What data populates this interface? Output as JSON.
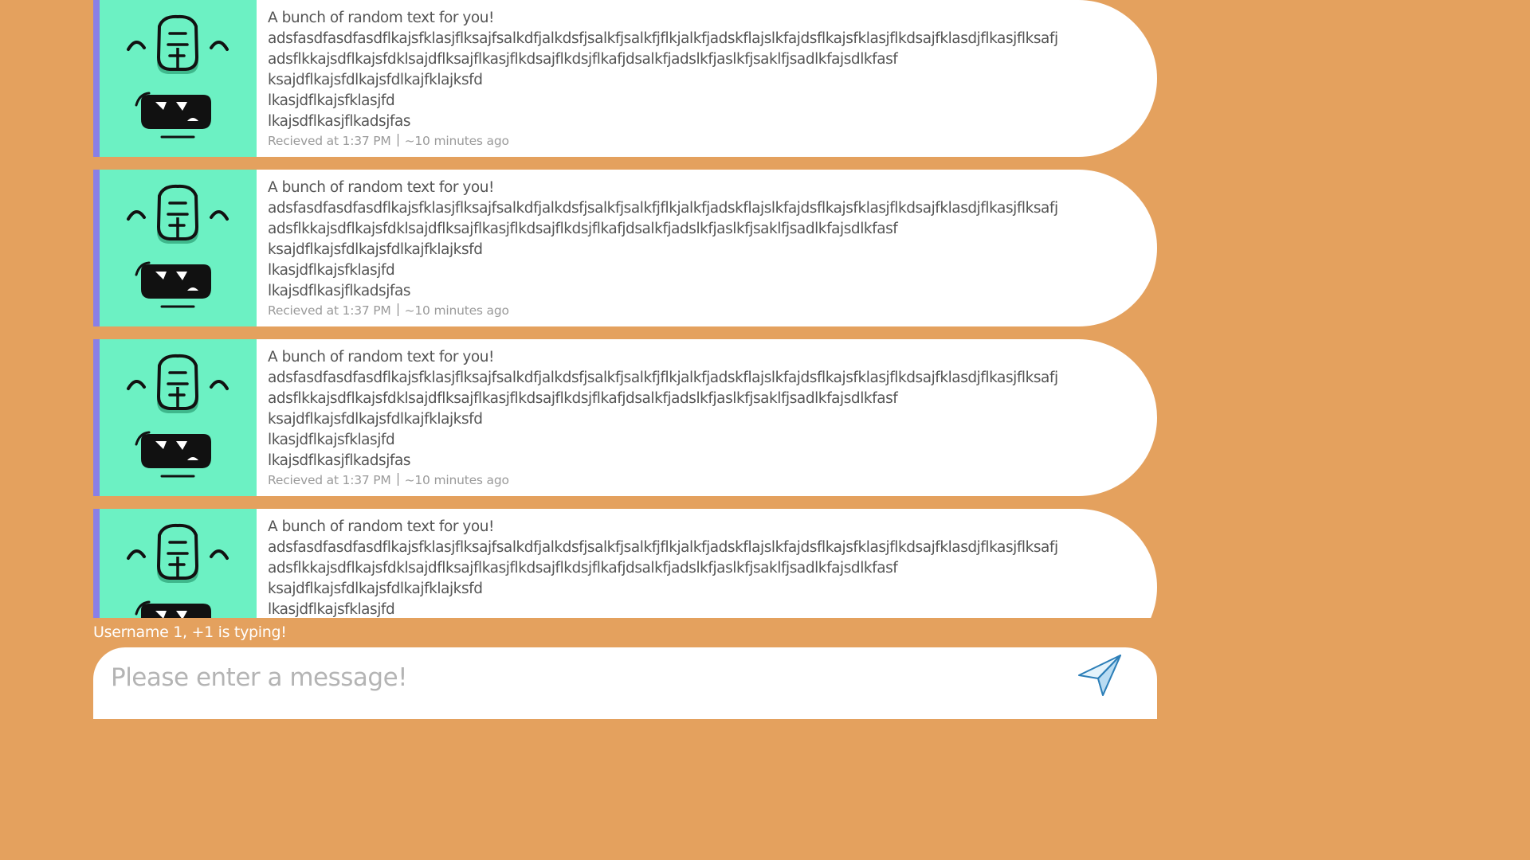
{
  "messages": [
    {
      "title": "A bunch of random text for you!",
      "lines": [
        "adsfasdfasdfasdflkajsfklasjflksajfsalkdfjalkdsfjsalkfjsalkfjflkjalkfjadskflajslkfajdsflkajsfklasjflkdsajfklasdjflkasjflksafj",
        "adsflkkajsdflkajsfdklsajdflksajflkasjflkdsajflkdsjflkafjdsalkfjadslkfjaslkfjsaklfjsadlkfajsdlkfasf",
        "ksajdflkajsfdlkajsfdlkajfklajksfd",
        "lkasjdflkajsfklasjfd",
        "lkajsdflkasjflkadsjfas"
      ],
      "received": "Recieved at 1:37 PM",
      "ago": "~10 minutes ago"
    },
    {
      "title": "A bunch of random text for you!",
      "lines": [
        "adsfasdfasdfasdflkajsfklasjflksajfsalkdfjalkdsfjsalkfjsalkfjflkjalkfjadskflajslkfajdsflkajsfklasjflkdsajfklasdjflkasjflksafj",
        "adsflkkajsdflkajsfdklsajdflksajflkasjflkdsajflkdsjflkafjdsalkfjadslkfjaslkfjsaklfjsadlkfajsdlkfasf",
        "ksajdflkajsfdlkajsfdlkajfklajksfd",
        "lkasjdflkajsfklasjfd",
        "lkajsdflkasjflkadsjfas"
      ],
      "received": "Recieved at 1:37 PM",
      "ago": "~10 minutes ago"
    },
    {
      "title": "A bunch of random text for you!",
      "lines": [
        "adsfasdfasdfasdflkajsfklasjflksajfsalkdfjalkdsfjsalkfjsalkfjflkjalkfjadskflajslkfajdsflkajsfklasjflkdsajfklasdjflkasjflksafj",
        "adsflkkajsdflkajsfdklsajdflksajflkasjflkdsajflkdsjflkafjdsalkfjadslkfjaslkfjsaklfjsadlkfajsdlkfasf",
        "ksajdflkajsfdlkajsfdlkajfklajksfd",
        "lkasjdflkajsfklasjfd",
        "lkajsdflkasjflkadsjfas"
      ],
      "received": "Recieved at 1:37 PM",
      "ago": "~10 minutes ago"
    },
    {
      "title": "A bunch of random text for you!",
      "lines": [
        "adsfasdfasdfasdflkajsfklasjflksajfsalkdfjalkdsfjsalkfjsalkfjflkjalkfjadskflajslkfajdsflkajsfklasjflkdsajfklasdjflkasjflksafj",
        "adsflkkajsdflkajsfdklsajdflksajflkasjflkdsajflkdsjflkafjdsalkfjadslkfjaslkfjsaklfjsadlkfajsdlkfasf",
        "ksajdflkajsfdlkajsfdlkajfklajksfd",
        "lkasjdflkajsfklasjfd"
      ],
      "received": "",
      "ago": ""
    }
  ],
  "typing": "Username 1, +1 is typing!",
  "composer": {
    "placeholder": "Please enter a message!",
    "send_icon": "paper-plane-icon"
  },
  "colors": {
    "background": "#E4A15E",
    "avatar_bg": "#6CF1C3",
    "accent": "#8a7fe6"
  },
  "avatar_icon": "monster-face-icon"
}
